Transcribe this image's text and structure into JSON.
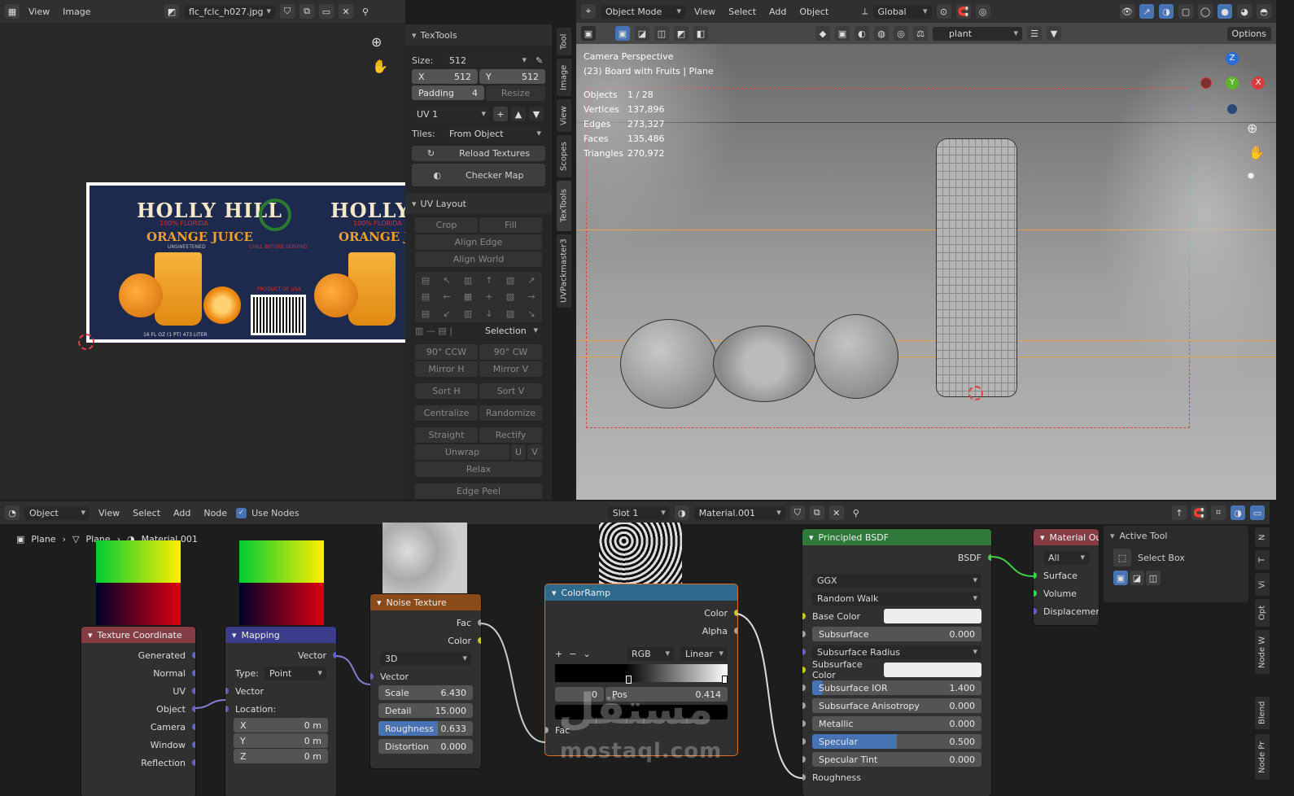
{
  "image_editor": {
    "menu": [
      "View",
      "Image"
    ],
    "image_name": "flc_fclc_h027.jpg",
    "label": {
      "brand": "HOLLY HILL",
      "sub": "100% FLORIDA",
      "product": "ORANGE JUICE",
      "note": "UNSWEETENED",
      "brand2": "HOLLY HI",
      "product2": "ORANGE JUIC",
      "sub2": "100% FLORIDA",
      "serving": "CHILL BEFORE SERVING",
      "made": "PRODUCT OF USA",
      "volume": "16 FL OZ (1 PT) 473 LITER"
    }
  },
  "textools": {
    "title": "TexTools",
    "size_label": "Size:",
    "size_value": "512",
    "x_label": "X",
    "x_value": "512",
    "y_label": "Y",
    "y_value": "512",
    "padding_label": "Padding",
    "padding_value": "4",
    "resize": "Resize",
    "uv_map": "UV 1",
    "tiles_label": "Tiles:",
    "tiles_value": "From Object",
    "reload": "Reload Textures",
    "checker": "Checker Map",
    "uv_layout": "UV Layout",
    "crop": "Crop",
    "fill": "Fill",
    "align_edge": "Align Edge",
    "align_world": "Align World",
    "selection": "Selection",
    "ccw": "90° CCW",
    "cw": "90° CW",
    "mirror_h": "Mirror H",
    "mirror_v": "Mirror V",
    "sort_h": "Sort H",
    "sort_v": "Sort V",
    "centralize": "Centralize",
    "randomize": "Randomize",
    "straight": "Straight",
    "rectify": "Rectify",
    "unwrap": "Unwrap",
    "u": "U",
    "v": "V",
    "relax": "Relax",
    "edge_peel": "Edge Peel",
    "tabs": [
      "Tool",
      "Image",
      "View",
      "Scopes",
      "TexTools",
      "UVPackmaster3"
    ]
  },
  "viewport": {
    "mode": "Object Mode",
    "menu": [
      "View",
      "Select",
      "Add",
      "Object"
    ],
    "orientation": "Global",
    "search": "plant",
    "options": "Options",
    "camera_title": "Camera Perspective",
    "scene_info": "(23) Board with Fruits | Plane",
    "stats": [
      {
        "k": "Objects",
        "v": "1 / 28"
      },
      {
        "k": "Vertices",
        "v": "137,896"
      },
      {
        "k": "Edges",
        "v": "273,327"
      },
      {
        "k": "Faces",
        "v": "135,486"
      },
      {
        "k": "Triangles",
        "v": "270,972"
      }
    ],
    "gizmo": {
      "x": "X",
      "y": "Y",
      "z": "Z"
    }
  },
  "node_editor": {
    "object_mode": "Object",
    "menu": [
      "View",
      "Select",
      "Add",
      "Node"
    ],
    "use_nodes": "Use Nodes",
    "slot": "Slot 1",
    "material": "Material.001",
    "breadcrumb": [
      "Plane",
      "Plane",
      "Material.001"
    ],
    "texcoord": {
      "title": "Texture Coordinate",
      "outputs": [
        "Generated",
        "Normal",
        "UV",
        "Object",
        "Camera",
        "Window",
        "Reflection"
      ]
    },
    "mapping": {
      "title": "Mapping",
      "out": "Vector",
      "type_label": "Type:",
      "type_value": "Point",
      "in_vector": "Vector",
      "location": "Location:",
      "loc": [
        {
          "k": "X",
          "v": "0 m"
        },
        {
          "k": "Y",
          "v": "0 m"
        },
        {
          "k": "Z",
          "v": "0 m"
        }
      ]
    },
    "noise": {
      "title": "Noise Texture",
      "out_fac": "Fac",
      "out_color": "Color",
      "dim": "3D",
      "in_vector": "Vector",
      "scale_label": "Scale",
      "scale": "6.430",
      "detail_label": "Detail",
      "detail": "15.000",
      "rough_label": "Roughness",
      "rough": "0.633",
      "dist_label": "Distortion",
      "dist": "0.000"
    },
    "ramp": {
      "title": "ColorRamp",
      "out_color": "Color",
      "out_alpha": "Alpha",
      "plus": "+",
      "minus": "−",
      "mode": "RGB",
      "interp": "Linear",
      "index": "0",
      "pos_label": "Pos",
      "pos": "0.414",
      "in_fac": "Fac"
    },
    "bsdf": {
      "title": "Principled BSDF",
      "out": "BSDF",
      "dist": "GGX",
      "sss": "Random Walk",
      "base_color": "Base Color",
      "subsurface": "Subsurface",
      "subsurface_v": "0.000",
      "sss_radius": "Subsurface Radius",
      "sss_color": "Subsurface Color",
      "sss_ior": "Subsurface IOR",
      "sss_ior_v": "1.400",
      "sss_aniso": "Subsurface Anisotropy",
      "sss_aniso_v": "0.000",
      "metallic": "Metallic",
      "metallic_v": "0.000",
      "specular": "Specular",
      "specular_v": "0.500",
      "spec_tint": "Specular Tint",
      "spec_tint_v": "0.000",
      "roughness": "Roughness"
    },
    "output": {
      "title": "Material Ou",
      "target": "All",
      "surface": "Surface",
      "volume": "Volume",
      "displacement": "Displacement"
    },
    "active_tool": {
      "title": "Active Tool",
      "tool": "Select Box"
    },
    "tabs": [
      "N",
      "T",
      "Vi",
      "Opt",
      "Node W",
      "Blend",
      "Node Pr"
    ]
  },
  "watermark": {
    "arabic": "مستقل",
    "latin": "mostaql.com"
  }
}
